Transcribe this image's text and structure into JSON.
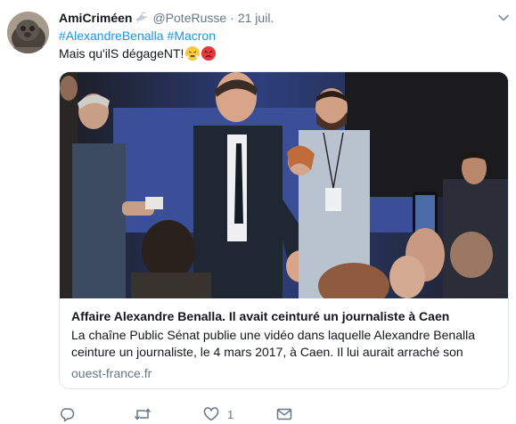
{
  "tweet": {
    "display_name": "AmiCriméen",
    "handle": "@PoteRusse",
    "separator": "·",
    "timestamp": "21 juil.",
    "hashtags": [
      "#AlexandreBenalla",
      "#Macron"
    ],
    "message": "Mais qu'ilS dégageNT!",
    "emojis": [
      "face-with-steam-emoji",
      "pouting-face-emoji"
    ]
  },
  "card": {
    "title": "Affaire Alexandre Benalla. Il avait ceinturé un journaliste à Caen",
    "description": "La chaîne Public Sénat publie une vidéo dans laquelle Alexandre Benalla ceinture un journaliste, le 4 mars 2017, à Caen. Il lui aurait arraché son",
    "domain": "ouest-france.fr"
  },
  "actions": {
    "reply_count": "",
    "retweet_count": "",
    "like_count": "1",
    "icons": [
      "reply-icon",
      "retweet-icon",
      "like-icon",
      "direct-message-icon"
    ]
  },
  "colors": {
    "link": "#1b95e0",
    "secondary_text": "#657786",
    "border": "#e1e8ed"
  }
}
